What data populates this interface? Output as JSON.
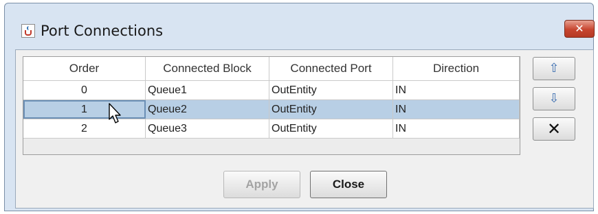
{
  "window": {
    "title": "Port Connections",
    "close_icon": "close-icon"
  },
  "table": {
    "columns": [
      "Order",
      "Connected Block",
      "Connected Port",
      "Direction"
    ],
    "rows": [
      {
        "order": "0",
        "block": "Queue1",
        "port": "OutEntity",
        "direction": "IN"
      },
      {
        "order": "1",
        "block": "Queue2",
        "port": "OutEntity",
        "direction": "IN",
        "selected": true
      },
      {
        "order": "2",
        "block": "Queue3",
        "port": "OutEntity",
        "direction": "IN"
      }
    ]
  },
  "side_buttons": {
    "up_icon": "arrow-up-icon",
    "down_icon": "arrow-down-icon",
    "delete_icon": "delete-icon"
  },
  "buttons": {
    "apply": "Apply",
    "close": "Close"
  },
  "colors": {
    "selection": "#b8cfe5",
    "close_button": "#c7452f"
  }
}
